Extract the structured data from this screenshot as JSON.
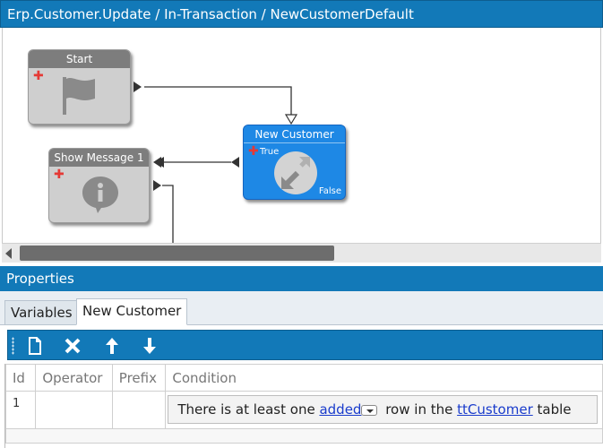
{
  "window": {
    "title": "Erp.Customer.Update / In-Transaction / NewCustomerDefault"
  },
  "workflow": {
    "nodes": {
      "start": {
        "label": "Start",
        "icon": "flag-icon"
      },
      "show_message": {
        "label": "Show Message 1",
        "icon": "info-icon"
      },
      "new_customer": {
        "label": "New Customer",
        "icon": "condition-arrows-icon",
        "true_label": "True",
        "false_label": "False"
      }
    }
  },
  "properties": {
    "title": "Properties",
    "tabs": [
      {
        "label": "Variables",
        "active": false
      },
      {
        "label": "New Customer",
        "active": true
      }
    ],
    "toolbar": {
      "buttons": [
        {
          "name": "new-document-icon"
        },
        {
          "name": "delete-icon"
        },
        {
          "name": "move-up-icon"
        },
        {
          "name": "move-down-icon"
        }
      ]
    },
    "grid": {
      "columns": [
        "Id",
        "Operator",
        "Prefix",
        "Condition"
      ],
      "rows": [
        {
          "id": "1",
          "operator": "",
          "prefix": "",
          "condition": {
            "text_before": "There is at least one ",
            "link1": "added",
            "text_middle": " row in the ",
            "link2": "ttCustomer",
            "text_after": " table"
          }
        }
      ]
    }
  },
  "colors": {
    "accent": "#1279b8",
    "node_gray": "#cfcfcf",
    "node_blue": "#1e88e5"
  }
}
